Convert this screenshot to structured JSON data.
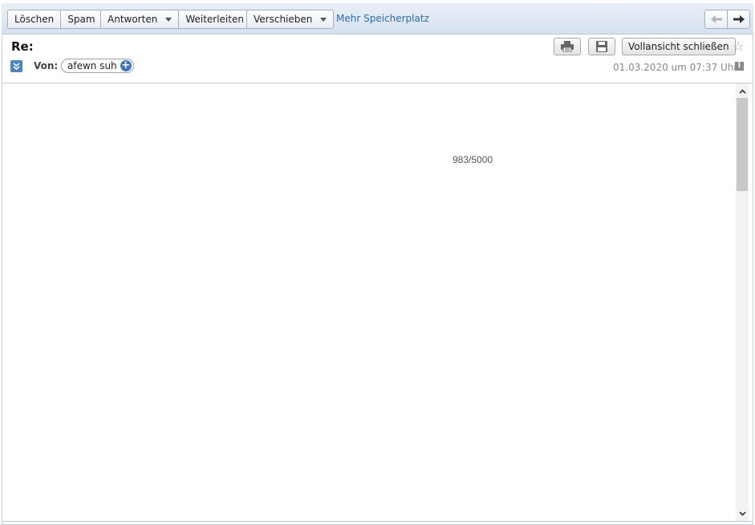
{
  "toolbar": {
    "delete_label": "Löschen",
    "spam_label": "Spam",
    "reply_label": "Antworten",
    "forward_label": "Weiterleiten",
    "move_label": "Verschieben",
    "storage_link": "Mehr Speicherplatz"
  },
  "header": {
    "subject": "Re:",
    "close_fullview_label": "Vollansicht schließen",
    "from_label": "Von:",
    "sender": "afewn suh",
    "date": "01.03.2020 um 07:37 Uhr"
  },
  "body": {
    "counter": "983/5000"
  },
  "icons": {
    "print": "printer-icon",
    "save": "floppy-disk-icon",
    "star": "star-icon",
    "prev": "arrow-left-icon",
    "next": "arrow-right-icon",
    "expand": "double-chevron-down-icon",
    "info": "info-icon",
    "add_contact": "plus-circle-icon"
  },
  "colors": {
    "accent": "#2d6db4",
    "toolbar_bg": "#dfe8f2"
  }
}
